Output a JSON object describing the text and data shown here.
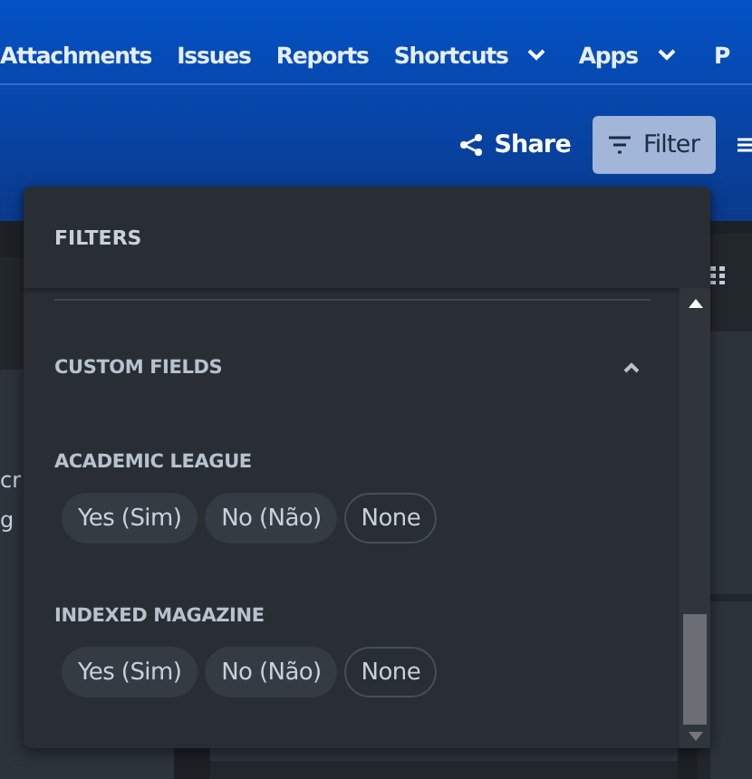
{
  "nav": [
    {
      "label": "Attachments",
      "dropdown": false
    },
    {
      "label": "Issues",
      "dropdown": false
    },
    {
      "label": "Reports",
      "dropdown": false
    },
    {
      "label": "Shortcuts",
      "dropdown": true
    },
    {
      "label": "Apps",
      "dropdown": true
    },
    {
      "label": "P",
      "dropdown": false
    }
  ],
  "toolbar": {
    "share": "Share",
    "filter": {
      "label": "Filter",
      "selected": true
    }
  },
  "board": {
    "left_card": [
      "cr",
      "g"
    ]
  },
  "filters": {
    "title": "FILTERS",
    "section": {
      "title": "CUSTOM FIELDS",
      "expanded": true
    },
    "groups": [
      {
        "title": "ACADEMIC LEAGUE",
        "options": [
          {
            "label": "Yes (Sim)",
            "kind": "value"
          },
          {
            "label": "No (Não)",
            "kind": "value"
          },
          {
            "label": "None",
            "kind": "empty"
          }
        ]
      },
      {
        "title": "INDEXED MAGAZINE",
        "options": [
          {
            "label": "Yes (Sim)",
            "kind": "value"
          },
          {
            "label": "No (Não)",
            "kind": "value"
          },
          {
            "label": "None",
            "kind": "empty"
          }
        ]
      }
    ]
  }
}
